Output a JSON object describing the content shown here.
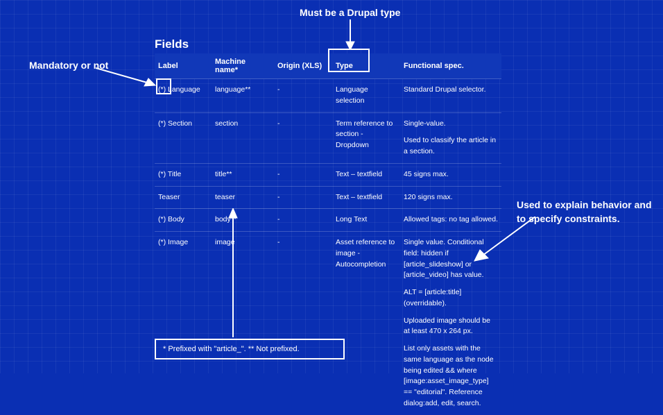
{
  "title": "Fields",
  "columns": [
    "Label",
    "Machine name*",
    "Origin (XLS)",
    "Type",
    "Functional spec."
  ],
  "rows": [
    {
      "label": "(*) Language",
      "machine": "language**",
      "origin": "-",
      "type": "Language selection",
      "spec": [
        "Standard Drupal selector."
      ]
    },
    {
      "label": "(*) Section",
      "machine": "section",
      "origin": "-",
      "type": "Term reference to section - Dropdown",
      "spec": [
        "Single-value.",
        "Used to classify the article in a section."
      ]
    },
    {
      "label": "(*) Title",
      "machine": "title**",
      "origin": "-",
      "type": "Text – textfield",
      "spec": [
        "45 signs max."
      ]
    },
    {
      "label": "Teaser",
      "machine": "teaser",
      "origin": "-",
      "type": "Text – textfield",
      "spec": [
        "120 signs max."
      ]
    },
    {
      "label": "(*) Body",
      "machine": "body**",
      "origin": "-",
      "type": "Long Text",
      "spec": [
        "Allowed tags: no tag allowed."
      ]
    },
    {
      "label": "(*) Image",
      "machine": "image",
      "origin": "-",
      "type": "Asset reference to image - Autocompletion",
      "spec": [
        "Single value. Conditional field: hidden if [article_slideshow] or [article_video] has value.",
        "ALT = [article:title] (overridable).",
        "Uploaded image should be at least 470 x 264 px.",
        "List only assets with the same language as the node being edited && where [image:asset_image_type] == \"editorial\". Reference dialog:add, edit, search."
      ]
    }
  ],
  "footnote": "* Prefixed with \"article_\". ** Not prefixed.",
  "callouts": {
    "top": "Must be a Drupal type",
    "left": "Mandatory or not",
    "right": "Used to explain behavior and to specify constraints."
  }
}
